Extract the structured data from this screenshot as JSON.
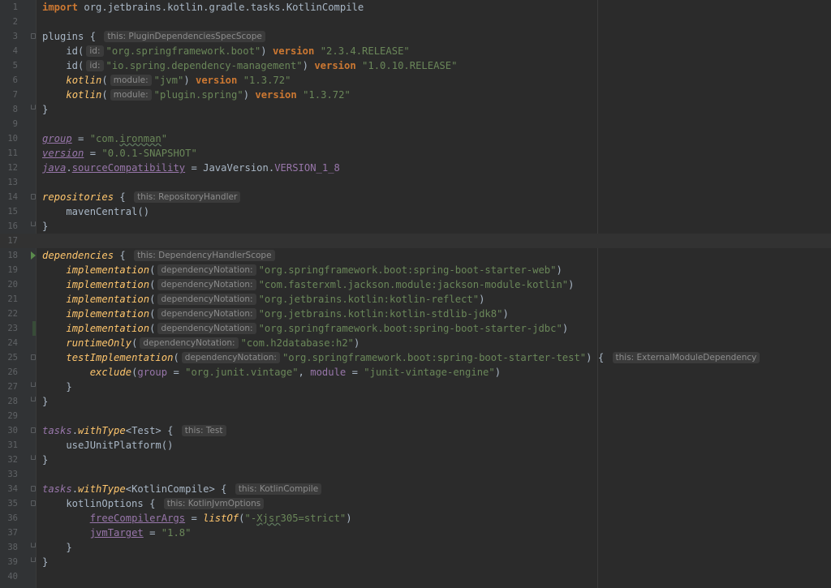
{
  "editor": {
    "file_language": "kotlin-gradle",
    "colors": {
      "background": "#2b2b2b",
      "keyword": "#cc7832",
      "string": "#6a8759",
      "function": "#ffc66d",
      "property": "#9876aa",
      "text": "#a9b7c6",
      "hint_bg": "#3b3b3b"
    },
    "lines": [
      {
        "n": "1",
        "segs": [
          {
            "c": "k",
            "t": "import"
          },
          {
            "c": "t",
            "t": " org.jetbrains.kotlin.gradle.tasks.KotlinCompile"
          }
        ]
      },
      {
        "n": "2",
        "segs": []
      },
      {
        "n": "3",
        "fold": "start",
        "segs": [
          {
            "c": "t",
            "t": "plugins { "
          },
          {
            "c": "hint",
            "t": "this: PluginDependenciesSpecScope"
          }
        ]
      },
      {
        "n": "4",
        "segs": [
          {
            "c": "t",
            "t": "    id("
          },
          {
            "c": "hint",
            "t": "id:"
          },
          {
            "c": "s",
            "t": "\"org.springframework.boot\""
          },
          {
            "c": "t",
            "t": ") "
          },
          {
            "c": "k",
            "t": "version"
          },
          {
            "c": "t",
            "t": " "
          },
          {
            "c": "s",
            "t": "\"2.3.4.RELEASE\""
          }
        ]
      },
      {
        "n": "5",
        "segs": [
          {
            "c": "t",
            "t": "    id("
          },
          {
            "c": "hint",
            "t": "id:"
          },
          {
            "c": "s",
            "t": "\"io.spring.dependency-management\""
          },
          {
            "c": "t",
            "t": ") "
          },
          {
            "c": "k",
            "t": "version"
          },
          {
            "c": "t",
            "t": " "
          },
          {
            "c": "s",
            "t": "\"1.0.10.RELEASE\""
          }
        ]
      },
      {
        "n": "6",
        "segs": [
          {
            "c": "t",
            "t": "    "
          },
          {
            "c": "f",
            "t": "kotlin"
          },
          {
            "c": "t",
            "t": "("
          },
          {
            "c": "hint",
            "t": "module:"
          },
          {
            "c": "s",
            "t": "\"jvm\""
          },
          {
            "c": "t",
            "t": ") "
          },
          {
            "c": "k",
            "t": "version"
          },
          {
            "c": "t",
            "t": " "
          },
          {
            "c": "s",
            "t": "\"1.3.72\""
          }
        ]
      },
      {
        "n": "7",
        "segs": [
          {
            "c": "t",
            "t": "    "
          },
          {
            "c": "f",
            "t": "kotlin"
          },
          {
            "c": "t",
            "t": "("
          },
          {
            "c": "hint",
            "t": "module:"
          },
          {
            "c": "s",
            "t": "\"plugin.spring\""
          },
          {
            "c": "t",
            "t": ") "
          },
          {
            "c": "k",
            "t": "version"
          },
          {
            "c": "t",
            "t": " "
          },
          {
            "c": "s",
            "t": "\"1.3.72\""
          }
        ]
      },
      {
        "n": "8",
        "fold": "end",
        "segs": [
          {
            "c": "t",
            "t": "}"
          }
        ]
      },
      {
        "n": "9",
        "segs": []
      },
      {
        "n": "10",
        "segs": [
          {
            "c": "pi u",
            "t": "group"
          },
          {
            "c": "t",
            "t": " = "
          },
          {
            "c": "s",
            "t": "\"com."
          },
          {
            "c": "s squig",
            "t": "ironman"
          },
          {
            "c": "s",
            "t": "\""
          }
        ]
      },
      {
        "n": "11",
        "segs": [
          {
            "c": "pi u",
            "t": "version"
          },
          {
            "c": "t",
            "t": " = "
          },
          {
            "c": "s",
            "t": "\"0.0.1-SNAPSHOT\""
          }
        ]
      },
      {
        "n": "12",
        "segs": [
          {
            "c": "pi u",
            "t": "java"
          },
          {
            "c": "t",
            "t": "."
          },
          {
            "c": "p u",
            "t": "sourceCompatibility"
          },
          {
            "c": "t",
            "t": " = JavaVersion."
          },
          {
            "c": "c",
            "t": "VERSION_1_8"
          }
        ]
      },
      {
        "n": "13",
        "segs": []
      },
      {
        "n": "14",
        "fold": "start",
        "segs": [
          {
            "c": "f2",
            "t": "repositories"
          },
          {
            "c": "t",
            "t": " { "
          },
          {
            "c": "hint",
            "t": "this: RepositoryHandler"
          }
        ]
      },
      {
        "n": "15",
        "segs": [
          {
            "c": "t",
            "t": "    mavenCentral()"
          }
        ]
      },
      {
        "n": "16",
        "fold": "end",
        "segs": [
          {
            "c": "t",
            "t": "}"
          }
        ]
      },
      {
        "n": "17",
        "current": true,
        "segs": []
      },
      {
        "n": "18",
        "fold": "start",
        "arrow": true,
        "segs": [
          {
            "c": "f2",
            "t": "dependencies"
          },
          {
            "c": "t",
            "t": " { "
          },
          {
            "c": "hint",
            "t": "this: DependencyHandlerScope"
          }
        ]
      },
      {
        "n": "19",
        "segs": [
          {
            "c": "t",
            "t": "    "
          },
          {
            "c": "f2",
            "t": "implementation"
          },
          {
            "c": "t",
            "t": "("
          },
          {
            "c": "hint",
            "t": "dependencyNotation:"
          },
          {
            "c": "s",
            "t": "\"org.springframework.boot:spring-boot-starter-web\""
          },
          {
            "c": "t",
            "t": ")"
          }
        ]
      },
      {
        "n": "20",
        "segs": [
          {
            "c": "t",
            "t": "    "
          },
          {
            "c": "f2",
            "t": "implementation"
          },
          {
            "c": "t",
            "t": "("
          },
          {
            "c": "hint",
            "t": "dependencyNotation:"
          },
          {
            "c": "s",
            "t": "\"com.fasterxml.jackson.module:jackson-module-kotlin\""
          },
          {
            "c": "t",
            "t": ")"
          }
        ]
      },
      {
        "n": "21",
        "segs": [
          {
            "c": "t",
            "t": "    "
          },
          {
            "c": "f2",
            "t": "implementation"
          },
          {
            "c": "t",
            "t": "("
          },
          {
            "c": "hint",
            "t": "dependencyNotation:"
          },
          {
            "c": "s",
            "t": "\"org.jetbrains.kotlin:kotlin-reflect\""
          },
          {
            "c": "t",
            "t": ")"
          }
        ]
      },
      {
        "n": "22",
        "segs": [
          {
            "c": "t",
            "t": "    "
          },
          {
            "c": "f2",
            "t": "implementation"
          },
          {
            "c": "t",
            "t": "("
          },
          {
            "c": "hint",
            "t": "dependencyNotation:"
          },
          {
            "c": "s",
            "t": "\"org.jetbrains.kotlin:kotlin-stdlib-jdk8\""
          },
          {
            "c": "t",
            "t": ")"
          }
        ]
      },
      {
        "n": "23",
        "changed": true,
        "segs": [
          {
            "c": "t",
            "t": "    "
          },
          {
            "c": "f2",
            "t": "implementation"
          },
          {
            "c": "t",
            "t": "("
          },
          {
            "c": "hint",
            "t": "dependencyNotation:"
          },
          {
            "c": "s",
            "t": "\"org.springframework.boot:spring-boot-starter-jdbc\""
          },
          {
            "c": "t",
            "t": ")"
          }
        ]
      },
      {
        "n": "24",
        "segs": [
          {
            "c": "t",
            "t": "    "
          },
          {
            "c": "f2",
            "t": "runtimeOnly"
          },
          {
            "c": "t",
            "t": "("
          },
          {
            "c": "hint",
            "t": "dependencyNotation:"
          },
          {
            "c": "s",
            "t": "\"com.h2database:h2\""
          },
          {
            "c": "t",
            "t": ")"
          }
        ]
      },
      {
        "n": "25",
        "fold": "start",
        "segs": [
          {
            "c": "t",
            "t": "    "
          },
          {
            "c": "f2",
            "t": "testImplementation"
          },
          {
            "c": "t",
            "t": "("
          },
          {
            "c": "hint",
            "t": "dependencyNotation:"
          },
          {
            "c": "s",
            "t": "\"org.springframework.boot:spring-boot-starter-test\""
          },
          {
            "c": "t",
            "t": ") { "
          },
          {
            "c": "hint",
            "t": "this: ExternalModuleDependency"
          }
        ]
      },
      {
        "n": "26",
        "segs": [
          {
            "c": "t",
            "t": "        "
          },
          {
            "c": "f2",
            "t": "exclude"
          },
          {
            "c": "t",
            "t": "("
          },
          {
            "c": "p",
            "t": "group"
          },
          {
            "c": "t",
            "t": " = "
          },
          {
            "c": "s",
            "t": "\"org.junit.vintage\""
          },
          {
            "c": "t",
            "t": ", "
          },
          {
            "c": "p",
            "t": "module"
          },
          {
            "c": "t",
            "t": " = "
          },
          {
            "c": "s",
            "t": "\"junit-vintage-engine\""
          },
          {
            "c": "t",
            "t": ")"
          }
        ]
      },
      {
        "n": "27",
        "fold": "end",
        "segs": [
          {
            "c": "t",
            "t": "    }"
          }
        ]
      },
      {
        "n": "28",
        "fold": "end",
        "segs": [
          {
            "c": "t",
            "t": "}"
          }
        ]
      },
      {
        "n": "29",
        "segs": []
      },
      {
        "n": "30",
        "fold": "start",
        "segs": [
          {
            "c": "pi",
            "t": "tasks"
          },
          {
            "c": "t",
            "t": "."
          },
          {
            "c": "f2",
            "t": "withType"
          },
          {
            "c": "t",
            "t": "<Test> { "
          },
          {
            "c": "hint",
            "t": "this: Test"
          }
        ]
      },
      {
        "n": "31",
        "segs": [
          {
            "c": "t",
            "t": "    useJUnitPlatform()"
          }
        ]
      },
      {
        "n": "32",
        "fold": "end",
        "segs": [
          {
            "c": "t",
            "t": "}"
          }
        ]
      },
      {
        "n": "33",
        "segs": []
      },
      {
        "n": "34",
        "fold": "start",
        "segs": [
          {
            "c": "pi",
            "t": "tasks"
          },
          {
            "c": "t",
            "t": "."
          },
          {
            "c": "f2",
            "t": "withType"
          },
          {
            "c": "t",
            "t": "<KotlinCompile> { "
          },
          {
            "c": "hint",
            "t": "this: KotlinCompile"
          }
        ]
      },
      {
        "n": "35",
        "fold": "start",
        "segs": [
          {
            "c": "t",
            "t": "    kotlinOptions { "
          },
          {
            "c": "hint",
            "t": "this: KotlinJvmOptions"
          }
        ]
      },
      {
        "n": "36",
        "segs": [
          {
            "c": "t",
            "t": "        "
          },
          {
            "c": "p u",
            "t": "freeCompilerArgs"
          },
          {
            "c": "t",
            "t": " = "
          },
          {
            "c": "f2",
            "t": "listOf"
          },
          {
            "c": "t",
            "t": "("
          },
          {
            "c": "s",
            "t": "\"-"
          },
          {
            "c": "s squig",
            "t": "Xjsr"
          },
          {
            "c": "s",
            "t": "305=strict\""
          },
          {
            "c": "t",
            "t": ")"
          }
        ]
      },
      {
        "n": "37",
        "segs": [
          {
            "c": "t",
            "t": "        "
          },
          {
            "c": "p u",
            "t": "jvmTarget"
          },
          {
            "c": "t",
            "t": " = "
          },
          {
            "c": "s",
            "t": "\"1.8\""
          }
        ]
      },
      {
        "n": "38",
        "fold": "end",
        "segs": [
          {
            "c": "t",
            "t": "    }"
          }
        ]
      },
      {
        "n": "39",
        "fold": "end",
        "segs": [
          {
            "c": "t",
            "t": "}"
          }
        ]
      },
      {
        "n": "40",
        "segs": []
      }
    ]
  }
}
